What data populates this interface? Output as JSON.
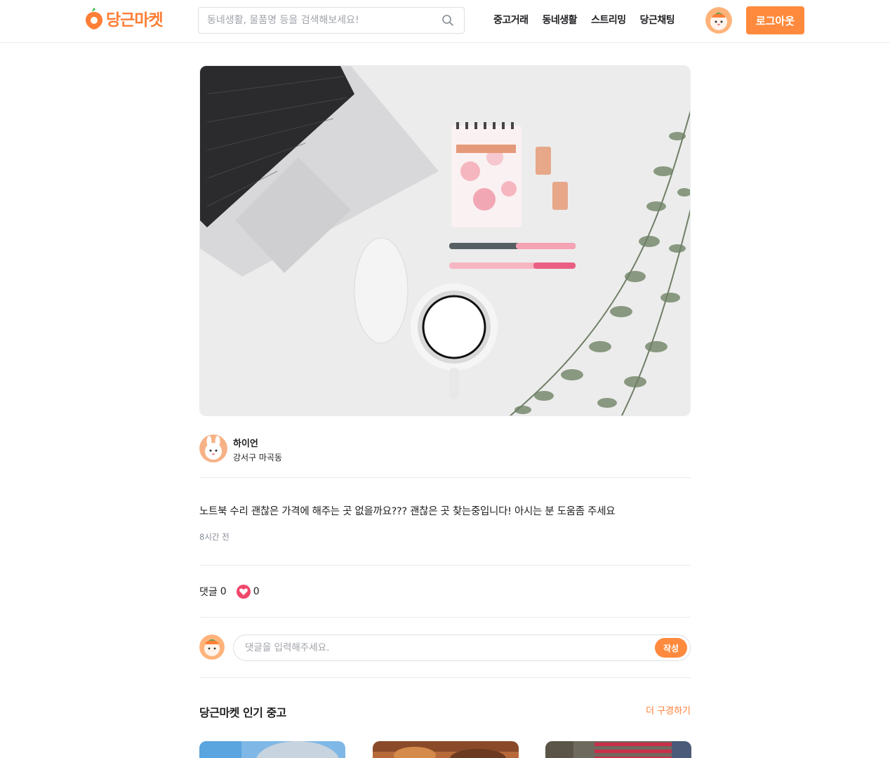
{
  "header": {
    "logo_text": "당근마켓",
    "search_placeholder": "동네생활, 물품명 등을 검색해보세요!",
    "nav": [
      "중고거래",
      "동네생활",
      "스트리밍",
      "당근채팅"
    ],
    "logout_label": "로그아웃"
  },
  "post": {
    "author_name": "하이언",
    "author_region": "강서구 마곡동",
    "body": "노트북 수리 괜찮은 가격에 해주는 곳 없을까요??? 괜찮은 곳 찾는중입니다! 아시는 분 도움좀 주세요",
    "time": "8시간 전",
    "comments_label": "댓글",
    "comments_count": "0",
    "likes_count": "0"
  },
  "comment": {
    "placeholder": "댓글을 입력해주세요.",
    "submit_label": "작성"
  },
  "popular": {
    "title": "당근마켓 인기 중고",
    "more_label": "더 구경하기"
  },
  "colors": {
    "brand": "#ff7e36",
    "button": "#ff8a3d",
    "heart": "#f0476b"
  },
  "icons": {
    "search": "search-icon",
    "heart": "heart-icon",
    "logo": "carrot-logo-icon"
  }
}
